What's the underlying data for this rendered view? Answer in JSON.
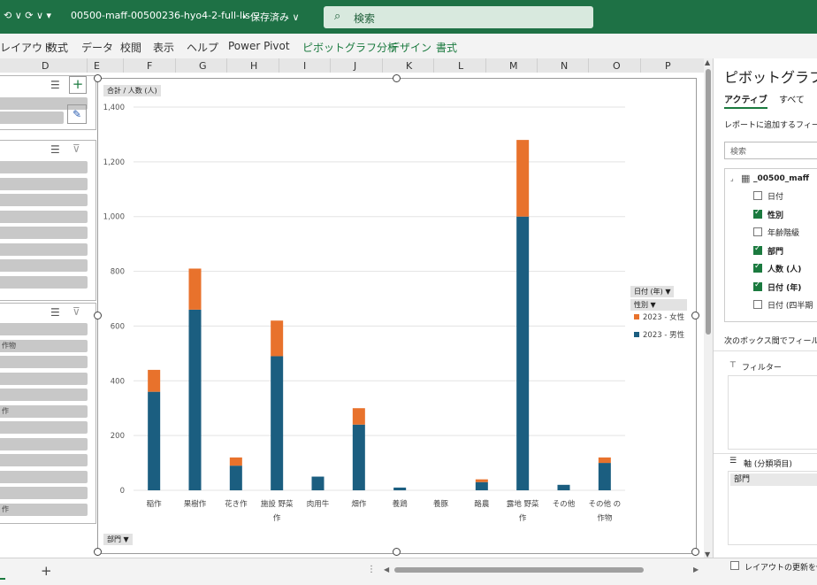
{
  "titlebar": {
    "undo_redo": "⟲ ∨  ⟳ ∨  ▾",
    "filename": "00500-maff-00500236-hyo4-2-full-lis···",
    "saved_status": "• 保存済み ∨",
    "search_placeholder": "検索"
  },
  "ribbon": {
    "tabs": [
      "レイアウト",
      "数式",
      "データ",
      "校閲",
      "表示",
      "ヘルプ",
      "Power Pivot"
    ],
    "context_tabs": [
      "ピボットグラフ分析",
      "デザイン",
      "書式"
    ]
  },
  "columns": [
    "D",
    "E",
    "F",
    "G",
    "H",
    "I",
    "J",
    "K",
    "L",
    "M",
    "N",
    "O",
    "P"
  ],
  "slicers": {
    "slicer2_items": [
      "",
      "",
      "",
      "",
      "",
      "",
      "",
      ""
    ],
    "slicer3_items": [
      "",
      "作物",
      "",
      "",
      "",
      "作",
      "",
      "",
      "",
      "",
      "",
      "作"
    ]
  },
  "chart": {
    "value_field_button": "合計 / 人数 (人)",
    "axis_field_button": "部門 ▼",
    "legend_field_button_1": "日付 (年) ▼",
    "legend_field_button_2": "性別 ▼"
  },
  "chart_data": {
    "type": "bar",
    "stacked": true,
    "categories": [
      [
        "稲作"
      ],
      [
        "果樹作"
      ],
      [
        "花き作"
      ],
      [
        "施設 野菜",
        "作"
      ],
      [
        "肉用牛"
      ],
      [
        "畑作"
      ],
      [
        "養鶏"
      ],
      [
        "養豚"
      ],
      [
        "酪農"
      ],
      [
        "露地 野菜",
        "作"
      ],
      [
        "その他"
      ],
      [
        "その他 の",
        "作物"
      ]
    ],
    "series": [
      {
        "name": "2023 - 男性",
        "color": "#1b5e80",
        "values": [
          360,
          660,
          90,
          490,
          50,
          240,
          10,
          0,
          30,
          1000,
          20,
          100
        ]
      },
      {
        "name": "2023 - 女性",
        "color": "#e8722c",
        "values": [
          80,
          150,
          30,
          130,
          0,
          60,
          0,
          0,
          10,
          280,
          0,
          20
        ]
      }
    ],
    "yticks": [
      "1,400",
      "1,200",
      "1,000",
      "800",
      "600",
      "400",
      "200",
      "0"
    ],
    "ylim": [
      0,
      1400
    ],
    "legend_position": "right",
    "gridlines": true
  },
  "pane": {
    "title": "ピボットグラフの",
    "tab_active": "アクティブ",
    "tab_all": "すべて",
    "instruction": "レポートに追加するフィール",
    "search_placeholder": "検索",
    "table_name": "_00500_maff",
    "fields": [
      {
        "label": "日付",
        "checked": false
      },
      {
        "label": "性別",
        "checked": true
      },
      {
        "label": "年齢階級",
        "checked": false
      },
      {
        "label": "部門",
        "checked": true
      },
      {
        "label": "人数 (人)",
        "checked": true
      },
      {
        "label": "日付 (年)",
        "checked": true
      },
      {
        "label": "日付 (四半期",
        "checked": false
      }
    ],
    "drag_instruction": "次のボックス間でフィールド",
    "filters_label": "フィルター",
    "axis_label": "軸 (分類項目)",
    "axis_value": "部門",
    "defer_update": "レイアウトの更新を保"
  },
  "bottom": {
    "add_sheet": "+"
  }
}
